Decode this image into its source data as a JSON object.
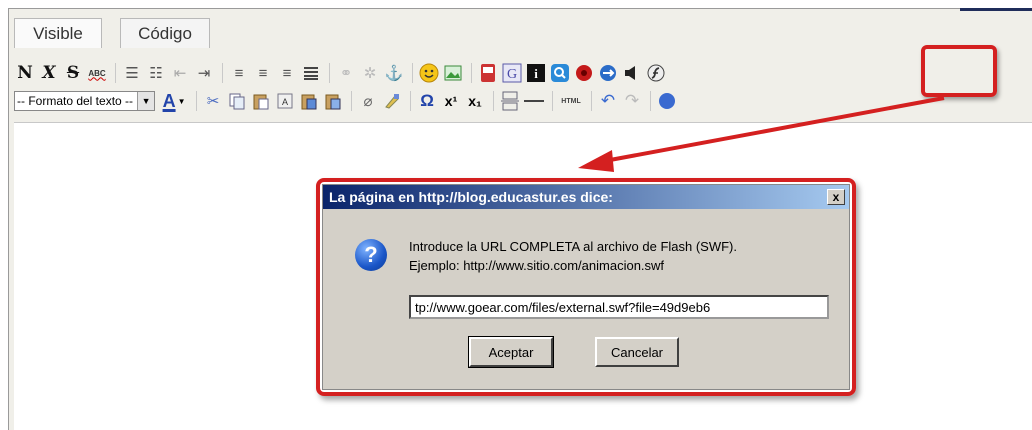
{
  "tabs": [
    {
      "label": "Visible"
    },
    {
      "label": "Código"
    }
  ],
  "toolbar1": {
    "bold": "N",
    "italic": "X",
    "strike": "S",
    "spell": "ABC"
  },
  "toolbar2": {
    "format_select": "-- Formato del texto --",
    "font_color": "A",
    "omega": "Ω",
    "superscript": "x¹",
    "subscript": "x₁",
    "html": "HTML"
  },
  "dialog": {
    "title": "La página en http://blog.educastur.es dice:",
    "close": "x",
    "icon": "?",
    "message_line1": "Introduce la URL COMPLETA al archivo de Flash (SWF).",
    "message_line2": "Ejemplo: http://www.sitio.com/animacion.swf",
    "input_value": "tp://www.goear.com/files/external.swf?file=49d9eb6",
    "ok_label": "Aceptar",
    "cancel_label": "Cancelar"
  },
  "colors": {
    "highlight": "#d42020",
    "titlebar": "#0a246a"
  },
  "icons": [
    "list-unordered-icon",
    "list-ordered-icon",
    "outdent-icon",
    "indent-icon",
    "align-left-icon",
    "align-center-icon",
    "align-right-icon",
    "align-justify-icon",
    "link-icon",
    "unlink-icon",
    "anchor-icon",
    "smiley-icon",
    "image-icon",
    "youtube-icon",
    "google-icon",
    "info-icon",
    "search-icon",
    "stop-icon",
    "globe-icon",
    "audio-icon",
    "flash-icon",
    "cut-icon",
    "copy-icon",
    "paste-icon",
    "paste-text-icon",
    "paste-word-icon",
    "clear-format-icon",
    "help-icon"
  ]
}
